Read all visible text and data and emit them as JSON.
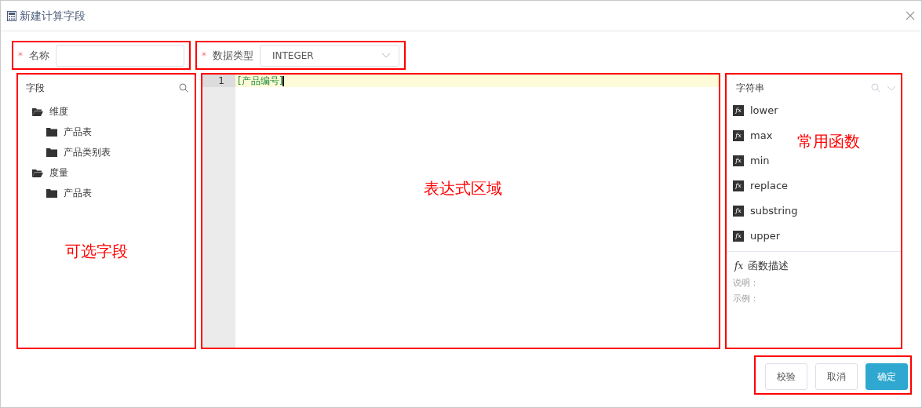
{
  "window": {
    "title": "新建计算字段"
  },
  "form": {
    "name_required_mark": "*",
    "name_label": "名称",
    "type_required_mark": "*",
    "type_label": "数据类型",
    "type_value": "INTEGER"
  },
  "fields_panel": {
    "title": "字段",
    "tree": [
      {
        "label": "维度",
        "expanded": true,
        "children": [
          {
            "label": "产品表",
            "expanded": false
          },
          {
            "label": "产品类别表",
            "expanded": false
          }
        ]
      },
      {
        "label": "度量",
        "expanded": true,
        "children": [
          {
            "label": "产品表",
            "expanded": false
          }
        ]
      }
    ],
    "annotation": "可选字段"
  },
  "editor": {
    "lines": [
      {
        "number": "1",
        "code": "[产品编号]"
      }
    ],
    "annotation": "表达式区域"
  },
  "functions_panel": {
    "category": "字符串",
    "functions": [
      {
        "icon": "fx",
        "name": "lower"
      },
      {
        "icon": "fx",
        "name": "max"
      },
      {
        "icon": "fx",
        "name": "min"
      },
      {
        "icon": "fx",
        "name": "replace"
      },
      {
        "icon": "fx",
        "name": "substring"
      },
      {
        "icon": "fx",
        "name": "upper"
      }
    ],
    "annotation": "常用函数",
    "description_icon": "fx",
    "description_title": "函数描述",
    "description_label": "说明：",
    "example_label": "示例："
  },
  "buttons": [
    {
      "label": "校验",
      "primary": false
    },
    {
      "label": "取消",
      "primary": false
    },
    {
      "label": "确定",
      "primary": true
    }
  ]
}
